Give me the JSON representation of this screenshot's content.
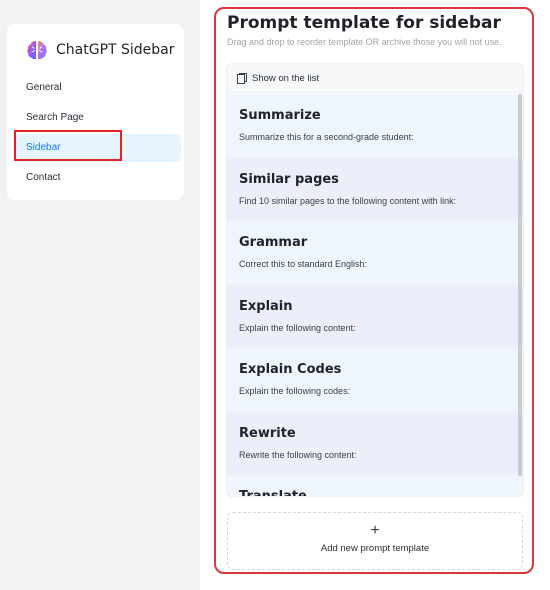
{
  "brand": {
    "name": "ChatGPT Sidebar",
    "logo": "brain-logo"
  },
  "nav": {
    "items": [
      {
        "label": "General"
      },
      {
        "label": "Search Page"
      },
      {
        "label": "Sidebar",
        "active": true
      },
      {
        "label": "Contact"
      }
    ]
  },
  "panel": {
    "title": "Prompt template for sidebar",
    "subtitle": "Drag and drop to reorder template OR archive those you will not use.",
    "list_header": "Show on the list",
    "templates": [
      {
        "name": "Summarize",
        "desc": "Summarize this for a second-grade student:"
      },
      {
        "name": "Similar pages",
        "desc": "Find 10 similar pages to the following content with link:"
      },
      {
        "name": "Grammar",
        "desc": "Correct this to standard English:"
      },
      {
        "name": "Explain",
        "desc": "Explain the following content:"
      },
      {
        "name": "Explain Codes",
        "desc": "Explain the following codes:"
      },
      {
        "name": "Rewrite",
        "desc": "Rewrite the following content:"
      },
      {
        "name": "Translate",
        "desc": ""
      }
    ],
    "add_icon": "+",
    "add_label": "Add new prompt template"
  },
  "colors": {
    "accent": "#1677ff",
    "highlight_border": "#e02424",
    "frame_border": "#d9363e"
  }
}
